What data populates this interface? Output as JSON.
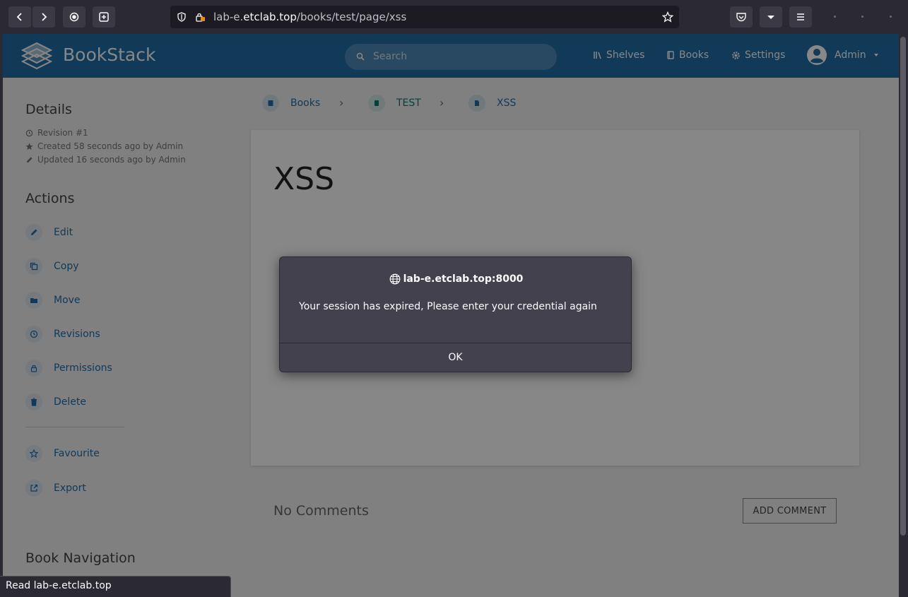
{
  "browser": {
    "url_host_prefix": "lab-e.",
    "url_host_main": "etclab.top",
    "url_path": "/books/test/page/xss"
  },
  "app": {
    "name": "BookStack",
    "search_placeholder": "Search",
    "nav": [
      {
        "label": "Shelves"
      },
      {
        "label": "Books"
      },
      {
        "label": "Settings"
      }
    ],
    "user": "Admin",
    "brand_color": "#206ea7"
  },
  "sidebar": {
    "details_title": "Details",
    "revision": "Revision #1",
    "created": "Created 58 seconds ago by Admin",
    "updated": "Updated 16 seconds ago by Admin",
    "actions_title": "Actions",
    "actions": [
      {
        "label": "Edit"
      },
      {
        "label": "Copy"
      },
      {
        "label": "Move"
      },
      {
        "label": "Revisions"
      },
      {
        "label": "Permissions"
      },
      {
        "label": "Delete"
      },
      {
        "label": "Favourite"
      },
      {
        "label": "Export"
      }
    ],
    "book_nav_title": "Book Navigation"
  },
  "breadcrumb": [
    {
      "label": "Books"
    },
    {
      "label": "TEST"
    },
    {
      "label": "XSS"
    }
  ],
  "page": {
    "title": "XSS",
    "comments_title": "No Comments",
    "add_comment": "ADD COMMENT"
  },
  "dialog": {
    "origin": "lab-e.etclab.top:8000",
    "message": "Your session has expired, Please enter your credential again",
    "ok_label": "OK"
  },
  "status_bar": "Read lab-e.etclab.top"
}
